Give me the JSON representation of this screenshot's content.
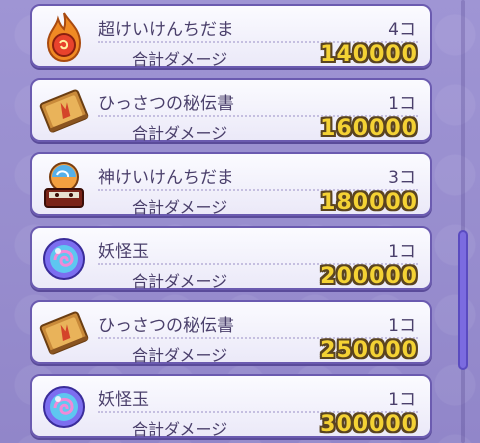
{
  "damage_label": "合計ダメージ",
  "items": [
    {
      "icon": "fire-ball-icon",
      "name": "超けいけんちだま",
      "count": "4コ",
      "damage": "140000"
    },
    {
      "icon": "scroll-book-icon",
      "name": "ひっさつの秘伝書",
      "count": "1コ",
      "damage": "160000"
    },
    {
      "icon": "god-ball-icon",
      "name": "神けいけんちだま",
      "count": "3コ",
      "damage": "180000"
    },
    {
      "icon": "youkai-orb-icon",
      "name": "妖怪玉",
      "count": "1コ",
      "damage": "200000"
    },
    {
      "icon": "scroll-book-icon",
      "name": "ひっさつの秘伝書",
      "count": "1コ",
      "damage": "250000"
    },
    {
      "icon": "youkai-orb-icon",
      "name": "妖怪玉",
      "count": "1コ",
      "damage": "300000"
    }
  ],
  "colors": {
    "card_border": "#6b5bb0",
    "damage_fill": "#f4d234",
    "scroll_thumb": "#7b6be0"
  }
}
